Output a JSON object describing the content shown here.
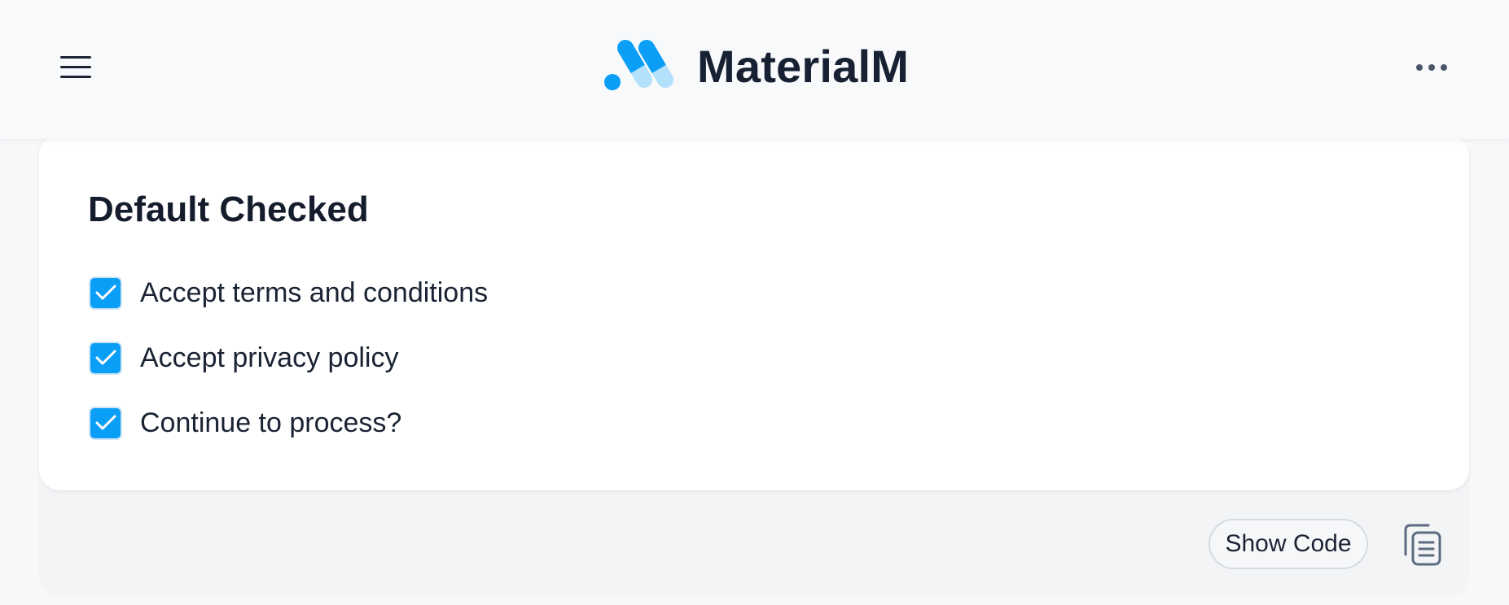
{
  "header": {
    "brand_name": "MaterialM",
    "menu_icon": "hamburger-menu-icon",
    "more_icon": "more-horizontal-icon",
    "logo_colors": [
      "#0a9ef7",
      "#b3e1fb"
    ]
  },
  "card": {
    "title": "Default Checked",
    "checkboxes": [
      {
        "label": "Accept terms and conditions",
        "checked": true
      },
      {
        "label": "Accept privacy policy",
        "checked": true
      },
      {
        "label": "Continue to process?",
        "checked": true
      }
    ]
  },
  "footer": {
    "show_code_label": "Show Code",
    "copy_icon": "copy-icon"
  },
  "colors": {
    "accent": "#0a9ef7",
    "accent_light": "#b3e1fb",
    "text_dark": "#151d2c",
    "background": "#f7f8fa"
  }
}
